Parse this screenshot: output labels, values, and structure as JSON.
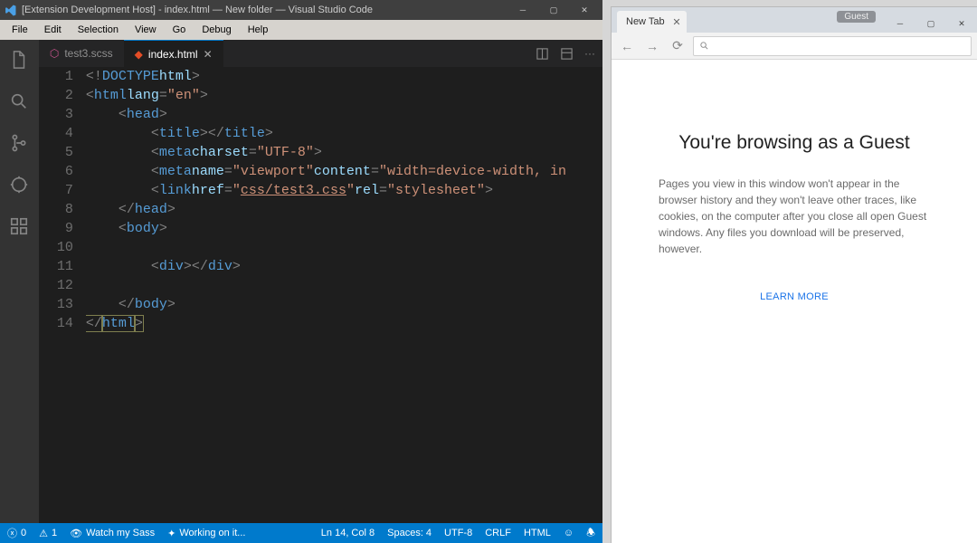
{
  "vscode": {
    "title": "[Extension Development Host] - index.html — New folder — Visual Studio Code",
    "menu": [
      "File",
      "Edit",
      "Selection",
      "View",
      "Go",
      "Debug",
      "Help"
    ],
    "tabs": [
      {
        "label": "test3.scss",
        "icon": "scss",
        "active": false
      },
      {
        "label": "index.html",
        "icon": "html",
        "active": true
      }
    ],
    "code_lines": [
      "1",
      "2",
      "3",
      "4",
      "5",
      "6",
      "7",
      "8",
      "9",
      "10",
      "11",
      "12",
      "13",
      "14"
    ],
    "code_tokens": [
      [
        [
          "",
          "punc",
          "<!"
        ],
        [
          "",
          "tag",
          "DOCTYPE"
        ],
        [
          "",
          " "
        ],
        [
          "",
          "attr",
          "html"
        ],
        [
          "",
          "punc",
          ">"
        ]
      ],
      [
        [
          "",
          "punc",
          "<"
        ],
        [
          "",
          "tag",
          "html"
        ],
        [
          "",
          " "
        ],
        [
          "",
          "attr",
          "lang"
        ],
        [
          "",
          "punc",
          "="
        ],
        [
          "",
          "str",
          "\"en\""
        ],
        [
          "",
          "punc",
          ">"
        ]
      ],
      [
        [
          "",
          "",
          "    "
        ],
        [
          "",
          "punc",
          "<"
        ],
        [
          "",
          "tag",
          "head"
        ],
        [
          "",
          "punc",
          ">"
        ]
      ],
      [
        [
          "",
          "",
          "        "
        ],
        [
          "",
          "punc",
          "<"
        ],
        [
          "",
          "tag",
          "title"
        ],
        [
          "",
          "punc",
          "></"
        ],
        [
          "",
          "tag",
          "title"
        ],
        [
          "",
          "punc",
          ">"
        ]
      ],
      [
        [
          "",
          "",
          "        "
        ],
        [
          "",
          "punc",
          "<"
        ],
        [
          "",
          "tag",
          "meta"
        ],
        [
          "",
          " "
        ],
        [
          "",
          "attr",
          "charset"
        ],
        [
          "",
          "punc",
          "="
        ],
        [
          "",
          "str",
          "\"UTF-8\""
        ],
        [
          "",
          "punc",
          ">"
        ]
      ],
      [
        [
          "",
          "",
          "        "
        ],
        [
          "",
          "punc",
          "<"
        ],
        [
          "",
          "tag",
          "meta"
        ],
        [
          "",
          " "
        ],
        [
          "",
          "attr",
          "name"
        ],
        [
          "",
          "punc",
          "="
        ],
        [
          "",
          "str",
          "\"viewport\""
        ],
        [
          "",
          " "
        ],
        [
          "",
          "attr",
          "content"
        ],
        [
          "",
          "punc",
          "="
        ],
        [
          "",
          "str",
          "\"width=device-width, in"
        ]
      ],
      [
        [
          "",
          "",
          "        "
        ],
        [
          "",
          "punc",
          "<"
        ],
        [
          "",
          "tag",
          "link"
        ],
        [
          "",
          " "
        ],
        [
          "",
          "attr",
          "href"
        ],
        [
          "",
          "punc",
          "="
        ],
        [
          "",
          "str",
          "\""
        ],
        [
          "",
          "link",
          "css/test3.css"
        ],
        [
          "",
          "str",
          "\""
        ],
        [
          "",
          " "
        ],
        [
          "",
          "attr",
          "rel"
        ],
        [
          "",
          "punc",
          "="
        ],
        [
          "",
          "str",
          "\"stylesheet\""
        ],
        [
          "",
          "punc",
          ">"
        ]
      ],
      [
        [
          "",
          "",
          "    "
        ],
        [
          "",
          "punc",
          "</"
        ],
        [
          "",
          "tag",
          "head"
        ],
        [
          "",
          "punc",
          ">"
        ]
      ],
      [
        [
          "",
          "",
          "    "
        ],
        [
          "",
          "punc",
          "<"
        ],
        [
          "",
          "tag",
          "body"
        ],
        [
          "",
          "punc",
          ">"
        ]
      ],
      [
        [
          "",
          "",
          ""
        ]
      ],
      [
        [
          "",
          "",
          "        "
        ],
        [
          "",
          "punc",
          "<"
        ],
        [
          "",
          "tag",
          "div"
        ],
        [
          "",
          "punc",
          "></"
        ],
        [
          "",
          "tag",
          "div"
        ],
        [
          "",
          "punc",
          ">"
        ]
      ],
      [
        [
          "",
          "",
          ""
        ]
      ],
      [
        [
          "",
          "",
          "    "
        ],
        [
          "",
          "punc",
          "</"
        ],
        [
          "",
          "tag",
          "body"
        ],
        [
          "",
          "punc",
          ">"
        ]
      ],
      [
        [
          "hl",
          "punc",
          "</"
        ],
        [
          "hl",
          "tag",
          "html"
        ],
        [
          "hl",
          "punc",
          ">"
        ]
      ]
    ],
    "status_left": {
      "errors": "0",
      "warnings": "1"
    },
    "status_mid": {
      "watch": "Watch my Sass",
      "working": "Working on it..."
    },
    "status_right": {
      "pos": "Ln 14, Col 8",
      "spaces": "Spaces: 4",
      "encoding": "UTF-8",
      "eol": "CRLF",
      "lang": "HTML"
    }
  },
  "chrome": {
    "tab_title": "New Tab",
    "guest_chip": "Guest",
    "heading": "You're browsing as a Guest",
    "body": "Pages you view in this window won't appear in the browser history and they won't leave other traces, like cookies, on the computer after you close all open Guest windows. Any files you download will be preserved, however.",
    "learn_more": "LEARN MORE"
  }
}
